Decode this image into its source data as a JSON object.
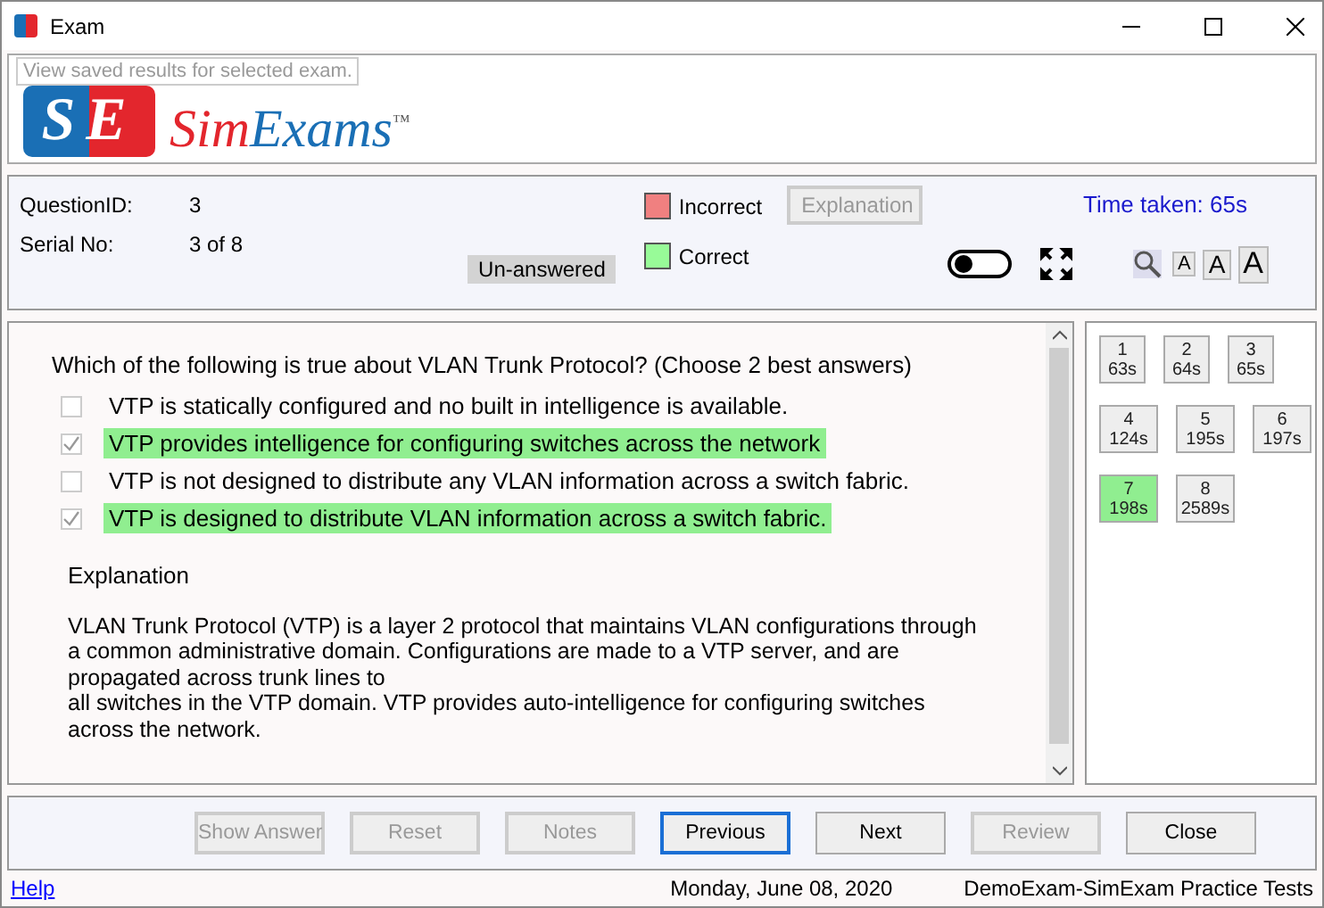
{
  "window": {
    "title": "Exam"
  },
  "logo": {
    "mark": "SE",
    "text_a": "Sim",
    "text_b": "Exams",
    "tm": "™"
  },
  "tooltip": "View saved results for selected exam.",
  "info": {
    "question_id_label": "QuestionID:",
    "question_id": "3",
    "serial_label": "Serial No:",
    "serial": "3 of 8",
    "status": "Un-answered",
    "legend": [
      {
        "label": "Incorrect",
        "color": "#f08080"
      },
      {
        "label": "Correct",
        "color": "#98fb98"
      }
    ],
    "explanation_button": {
      "label": "Explanation",
      "disabled": true
    },
    "time_taken": "Time taken: 65s",
    "toggle_on": false,
    "font_buttons": [
      {
        "label": "A",
        "kind": "small"
      },
      {
        "label": "A",
        "kind": "medium"
      },
      {
        "label": "A",
        "kind": "large"
      }
    ]
  },
  "question": {
    "text": "Which of the following is true about VLAN Trunk Protocol? (Choose 2 best answers)",
    "options": [
      {
        "text": "VTP is statically configured and no built in intelligence is available.",
        "checked": false,
        "correct": false
      },
      {
        "text": "VTP provides intelligence for configuring switches across the network",
        "checked": true,
        "correct": true
      },
      {
        "text": "VTP is not designed to distribute any VLAN information across a switch fabric.",
        "checked": false,
        "correct": false
      },
      {
        "text": "VTP is designed to distribute VLAN information across a switch fabric.",
        "checked": true,
        "correct": true
      }
    ],
    "explanation_title": "Explanation",
    "explanation_lines": [
      "VLAN Trunk Protocol (VTP) is a layer 2 protocol that maintains VLAN configurations through",
      "a common administrative domain. Configurations are made to a VTP server, and are",
      "propagated across trunk lines to",
      "all switches in the VTP domain. VTP provides auto-intelligence for configuring switches",
      "across the network."
    ]
  },
  "question_grid": [
    [
      {
        "number": "1",
        "time": "63s",
        "selected": false
      },
      {
        "number": "2",
        "time": "64s",
        "selected": false
      },
      {
        "number": "3",
        "time": "65s",
        "selected": false
      }
    ],
    [
      {
        "number": "4",
        "time": "124s",
        "selected": false
      },
      {
        "number": "5",
        "time": "195s",
        "selected": false
      },
      {
        "number": "6",
        "time": "197s",
        "selected": false
      }
    ],
    [
      {
        "number": "7",
        "time": "198s",
        "selected": true
      },
      {
        "number": "8",
        "time": "2589s",
        "selected": false
      }
    ]
  ],
  "buttons": [
    {
      "label": "Show Answer",
      "disabled": true,
      "focused": false
    },
    {
      "label": "Reset",
      "disabled": true,
      "focused": false
    },
    {
      "label": "Notes",
      "disabled": true,
      "focused": false
    },
    {
      "label": "Previous",
      "disabled": false,
      "focused": true
    },
    {
      "label": "Next",
      "disabled": false,
      "focused": false
    },
    {
      "label": "Review",
      "disabled": true,
      "focused": false
    },
    {
      "label": "Close",
      "disabled": false,
      "focused": false
    }
  ],
  "status_bar": {
    "help": "Help",
    "date": "Monday, June 08, 2020",
    "product": "DemoExam-SimExam Practice Tests"
  }
}
